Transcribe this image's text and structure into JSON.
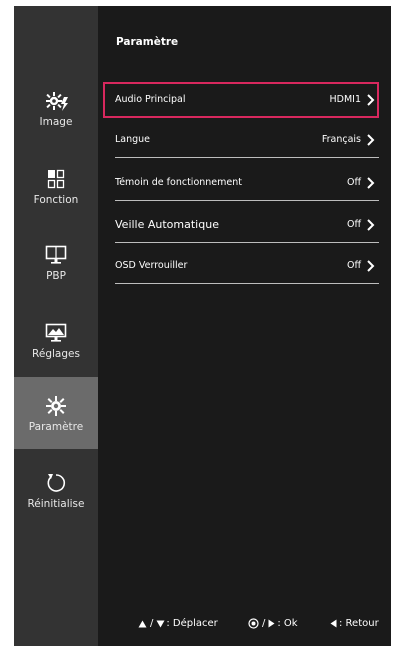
{
  "panel": {
    "title": "Paramètre"
  },
  "sidebar": {
    "items": [
      {
        "label": "Image",
        "icon": "gear-sun-icon",
        "active": false
      },
      {
        "label": "Fonction",
        "icon": "grid-icon",
        "active": false
      },
      {
        "label": "PBP",
        "icon": "monitor-icon",
        "active": false
      },
      {
        "label": "Réglages",
        "icon": "landscape-monitor-icon",
        "active": false
      },
      {
        "label": "Paramètre",
        "icon": "gear-icon",
        "active": true
      },
      {
        "label": "Réinitialise",
        "icon": "reset-icon",
        "active": false
      }
    ]
  },
  "settings": {
    "rows": [
      {
        "label": "Audio Principal",
        "value": "HDMI1",
        "selected": true
      },
      {
        "label": "Langue",
        "value": "Français",
        "selected": false
      },
      {
        "label": "Témoin de fonctionnement",
        "value": "Off",
        "selected": false
      },
      {
        "label": "Veille Automatique",
        "value": "Off",
        "selected": false
      },
      {
        "label": "OSD Verrouiller",
        "value": "Off",
        "selected": false
      }
    ]
  },
  "footer": {
    "move_label": ": Déplacer",
    "ok_label": ": Ok",
    "back_label": ": Retour"
  },
  "colors": {
    "selection_border": "#d8285e",
    "sidebar_bg": "#333333",
    "sidebar_active_bg": "#6b6b6b",
    "panel_bg": "#1a1a1a"
  }
}
